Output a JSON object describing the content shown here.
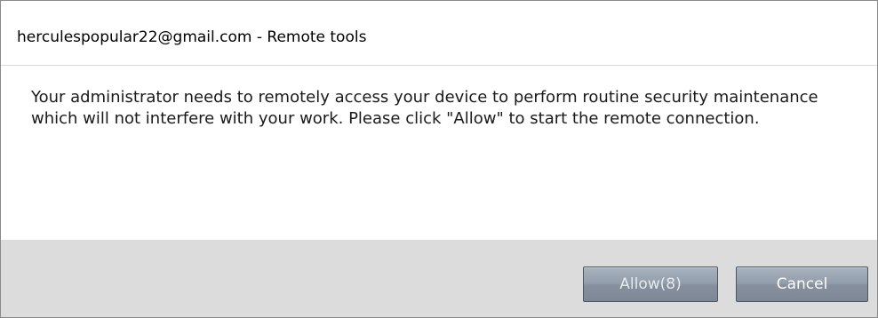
{
  "window": {
    "title": "herculespopular22@gmail.com - Remote tools"
  },
  "dialog": {
    "message": "Your administrator needs to remotely access your device to perform routine security maintenance which will not interfere with your work. Please click \"Allow\" to start the remote connection."
  },
  "buttons": {
    "allow_label": "Allow(8)",
    "cancel_label": "Cancel"
  }
}
